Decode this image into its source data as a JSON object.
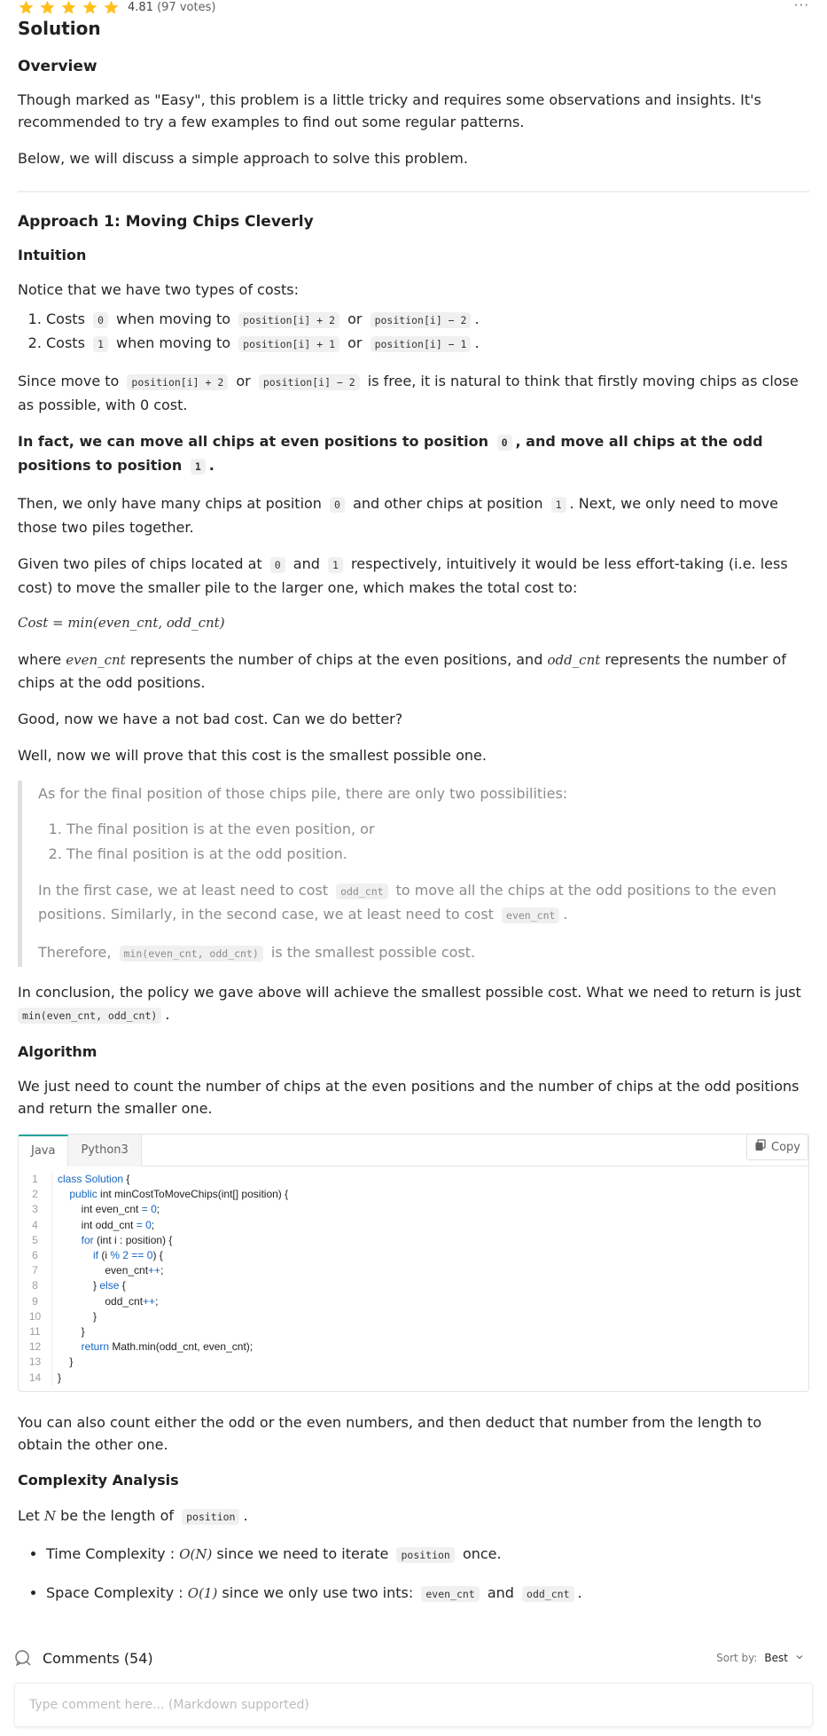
{
  "rating": {
    "value": "4.81",
    "votes": "(97 votes)",
    "star_count": 5,
    "star_color": "#ffc01e",
    "more": "···"
  },
  "title": "Solution",
  "overview": {
    "heading": "Overview",
    "p1": "Though marked as \"Easy\", this problem is a little tricky and requires some observations and insights. It's recommended to try a few examples to find out some regular patterns.",
    "p2": "Below, we will discuss a simple approach to solve this problem."
  },
  "approach": {
    "heading": "Approach 1: Moving Chips Cleverly",
    "intuition_heading": "Intuition",
    "intro": "Notice that we have two types of costs:",
    "costs": [
      {
        "pre": "Costs",
        "code1": "0",
        "mid": "when moving to",
        "code2": "position[i] + 2",
        "or": "or",
        "code3": "position[i] − 2",
        "end": "."
      },
      {
        "pre": "Costs",
        "code1": "1",
        "mid": "when moving to",
        "code2": "position[i] + 1",
        "or": "or",
        "code3": "position[i] − 1",
        "end": "."
      }
    ],
    "since": {
      "pre": "Since move to",
      "code1": "position[i] + 2",
      "or": "or",
      "code2": "position[i] − 2",
      "post": "is free, it is natural to think that firstly moving chips as close as possible, with 0 cost."
    },
    "bold": {
      "pre": "In fact, we can move all chips at even positions to position",
      "code1": "0",
      "mid": ", and move all chips at the odd positions to position",
      "code2": "1",
      "end": "."
    },
    "then": {
      "pre": "Then, we only have many chips at position",
      "code1": "0",
      "mid": "and other chips at position",
      "code2": "1",
      "post": ". Next, we only need to move those two piles together."
    },
    "given": {
      "pre": "Given two piles of chips located at",
      "code1": "0",
      "and": "and",
      "code2": "1",
      "post": "respectively, intuitively it would be less effort-taking (i.e. less cost) to move the smaller pile to the larger one, which makes the total cost to:"
    },
    "formula": "Cost = min(even_cnt, odd_cnt)",
    "where": {
      "pre": "where",
      "m1": "even_cnt",
      "mid": "represents the number of chips at the even positions, and",
      "m2": "odd_cnt",
      "post": "represents the number of chips at the odd positions."
    },
    "good": "Good, now we have a not bad cost. Can we do better?",
    "well": "Well, now we will prove that this cost is the smallest possible one.",
    "quote": {
      "intro": "As for the final position of those chips pile, there are only two possibilities:",
      "items": [
        "The final position is at the even position, or",
        "The final position is at the odd position."
      ],
      "first": {
        "pre": "In the first case, we at least need to cost",
        "code1": "odd_cnt",
        "mid": "to move all the chips at the odd positions to the even positions. Similarly, in the second case, we at least need to cost",
        "code2": "even_cnt",
        "end": "."
      },
      "therefore": {
        "pre": "Therefore,",
        "code": "min(even_cnt, odd_cnt)",
        "post": "is the smallest possible cost."
      }
    },
    "conclusion": {
      "pre": "In conclusion, the policy we gave above will achieve the smallest possible cost. What we need to return is just",
      "code": "min(even_cnt, odd_cnt)",
      "end": "."
    },
    "algorithm_heading": "Algorithm",
    "algorithm_text": "We just need to count the number of chips at the even positions and the number of chips at the odd positions and return the smaller one.",
    "after_code": "You can also count either the odd or the even numbers, and then deduct that number from the length to obtain the other one."
  },
  "code": {
    "tabs": [
      "Java",
      "Python3"
    ],
    "active_tab": "Java",
    "copy_label": "Copy",
    "line_numbers": [
      "1",
      "2",
      "3",
      "4",
      "5",
      "6",
      "7",
      "8",
      "9",
      "10",
      "11",
      "12",
      "13",
      "14"
    ]
  },
  "complexity": {
    "heading": "Complexity Analysis",
    "let": {
      "pre": "Let",
      "math": "N",
      "mid": "be the length of",
      "code": "position",
      "end": "."
    },
    "time": {
      "label": "Time Complexity :",
      "math": "O(N)",
      "post": "since we need to iterate",
      "code": "position",
      "end": "once."
    },
    "space": {
      "label": "Space Complexity :",
      "math": "O(1)",
      "post": "since we only use two ints:",
      "code1": "even_cnt",
      "and": "and",
      "code2": "odd_cnt",
      "end": "."
    }
  },
  "comments": {
    "label": "Comments (54)",
    "sort_label": "Sort by:",
    "sort_value": "Best",
    "placeholder": "Type comment here... (Markdown supported)"
  }
}
